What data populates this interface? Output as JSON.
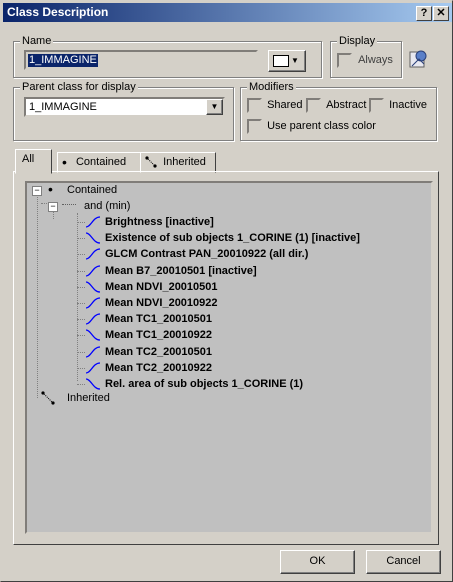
{
  "window": {
    "title": "Class Description",
    "help_button": "?",
    "close_button": "✕"
  },
  "name_group": {
    "label": "Name",
    "value": "1_IMMAGINE",
    "color_swatch": "#ffffff"
  },
  "display_group": {
    "label": "Display",
    "always_label": "Always",
    "always_checked": false
  },
  "parent_group": {
    "label": "Parent class for display",
    "selected": "1_IMMAGINE"
  },
  "modifiers_group": {
    "label": "Modifiers",
    "shared_label": "Shared",
    "abstract_label": "Abstract",
    "inactive_label": "Inactive",
    "use_parent_label": "Use parent class color"
  },
  "tabs": [
    {
      "label": "All",
      "icon": "none"
    },
    {
      "label": "Contained",
      "icon": "dot-icon"
    },
    {
      "label": "Inherited",
      "icon": "inherit-icon"
    }
  ],
  "tree": {
    "root_label": "Contained",
    "and_label": "and (min)",
    "features": [
      "Brightness [inactive]",
      "Existence of sub objects 1_CORINE (1) [inactive]",
      "GLCM Contrast PAN_20010922 (all dir.)",
      "Mean B7_20010501 [inactive]",
      "Mean NDVI_20010501",
      "Mean NDVI_20010922",
      "Mean TC1_20010501",
      "Mean TC1_20010922",
      "Mean TC2_20010501",
      "Mean TC2_20010922",
      "Rel. area of sub objects 1_CORINE (1)"
    ],
    "inherited_label": "Inherited",
    "curve_color": "#0000ff"
  },
  "buttons": {
    "ok": "OK",
    "cancel": "Cancel"
  }
}
